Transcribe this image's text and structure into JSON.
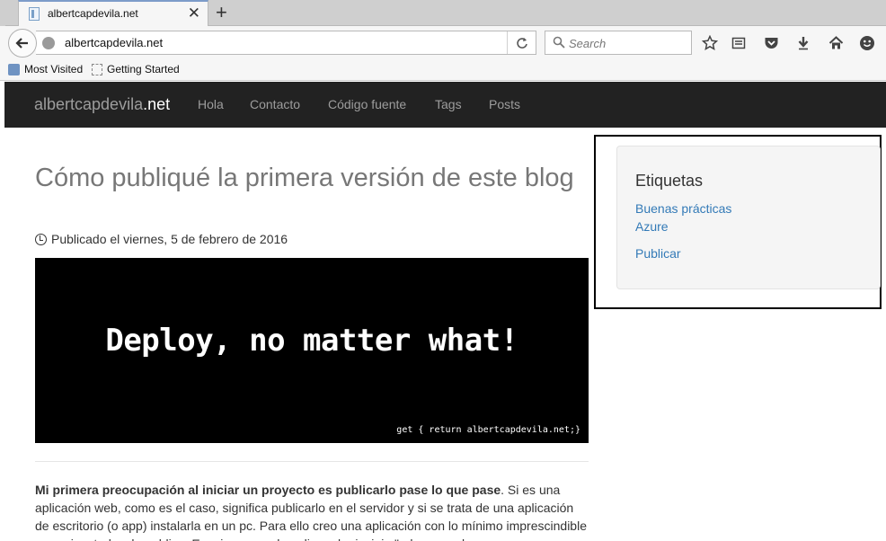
{
  "browser": {
    "tab_title": "albertcapdevila.net",
    "tab_close": "✕",
    "new_tab": "+",
    "url": "albertcapdevila.net",
    "search_placeholder": "Search",
    "bookmarks": [
      "Most Visited",
      "Getting Started"
    ]
  },
  "site": {
    "brand_name": "albertcapdevila",
    "brand_tld": ".net",
    "nav": [
      "Hola",
      "Contacto",
      "Código fuente",
      "Tags",
      "Posts"
    ]
  },
  "post": {
    "title": "Cómo publiqué la primera versión de este blog",
    "meta": "Publicado el viernes, 5 de febrero de 2016",
    "hero_title": "Deploy, no matter what!",
    "hero_sub": "get { return albertcapdevila.net;}",
    "lead_bold": "Mi primera preocupación al iniciar un proyecto es publicarlo pase lo que pase",
    "lead_rest": ". Si es una aplicación web, como es el caso, significa publicarlo en el servidor y si se trata de una aplicación de escritorio (o app) instalarla en un pc. Para ello creo una aplicación con lo mínimo imprescindible para ejecutarla y la publico. Es mi manera de aplicar el principio \"release early"
  },
  "sidebar": {
    "title": "Etiquetas",
    "tags": [
      "Buenas prácticas",
      "Azure",
      "Publicar"
    ]
  },
  "colors": {
    "navbar_bg": "#222222",
    "link": "#337ab7",
    "hero_bg": "#000000"
  }
}
